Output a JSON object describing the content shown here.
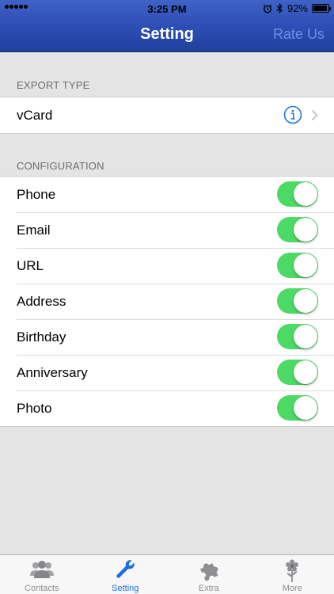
{
  "status_bar": {
    "time": "3:25 PM",
    "battery": "92%",
    "battery_level": 0.92
  },
  "nav": {
    "title": "Setting",
    "right_button": "Rate Us"
  },
  "export_section": {
    "header": "EXPORT TYPE",
    "item_label": "vCard"
  },
  "config_section": {
    "header": "CONFIGURATION",
    "items": [
      {
        "label": "Phone",
        "enabled": true
      },
      {
        "label": "Email",
        "enabled": true
      },
      {
        "label": "URL",
        "enabled": true
      },
      {
        "label": "Address",
        "enabled": true
      },
      {
        "label": "Birthday",
        "enabled": true
      },
      {
        "label": "Anniversary",
        "enabled": true
      },
      {
        "label": "Photo",
        "enabled": true
      }
    ]
  },
  "tabs": [
    {
      "label": "Contacts",
      "icon": "contacts-icon",
      "active": false
    },
    {
      "label": "Setting",
      "icon": "wrench-icon",
      "active": true
    },
    {
      "label": "Extra",
      "icon": "puzzle-icon",
      "active": false
    },
    {
      "label": "More",
      "icon": "flower-icon",
      "active": false
    }
  ],
  "colors": {
    "nav_bar": "#2c4db3",
    "accent": "#1a6fe0",
    "toggle_on": "#4cd964",
    "rate_us": "#6e8fe6",
    "background": "#e4e4e4"
  }
}
